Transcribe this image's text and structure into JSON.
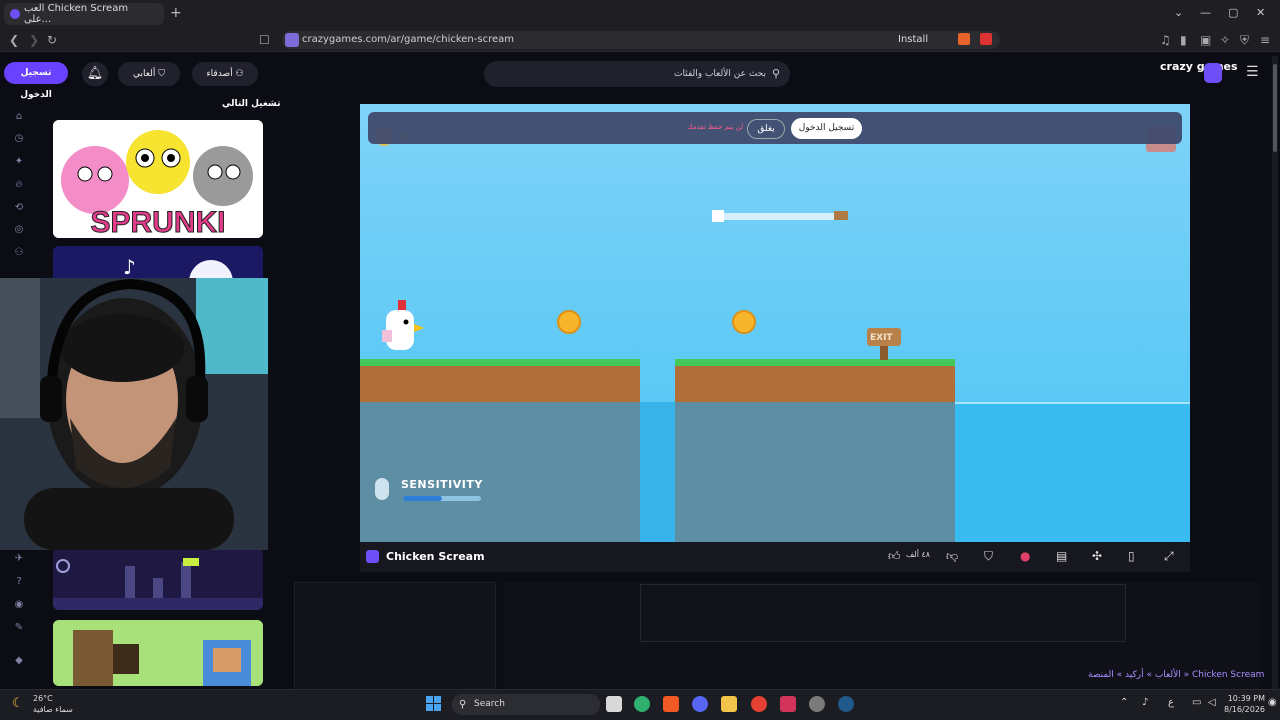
{
  "browser": {
    "tab_title": "العب Chicken Scream على...",
    "new_tab": "+",
    "url": "crazygames.com/ar/game/chicken-scream",
    "install_label": "Install",
    "minimize": "⌄  —  ▢  ✕"
  },
  "header": {
    "login": "تسجيل الدخول",
    "my_games": "ألعابي",
    "friends": "أصدقاء",
    "search_placeholder": "بحث عن الألعاب والفئات",
    "logo": "crazy games",
    "brand_color": "#6842ff"
  },
  "sidebar": {
    "next_play": "تشغيل التالي",
    "thumb1_text": "SPRUNKI"
  },
  "game": {
    "top_message": "لن يتم حفظ تقدمك",
    "skip": "يغلق",
    "login": "تسجيل الدخول",
    "sensitivity": "SENSITIVITY",
    "exit_sign": "EXIT",
    "sensitivity_level": 0.5
  },
  "gamebar": {
    "title": "Chicken Scream",
    "likes": "٤٨ ألف"
  },
  "breadcrumbs": "الألعاب » أركيد » المنصة » Chicken Scream",
  "taskbar": {
    "temp": "26°C",
    "weather": "سماء صافية",
    "search": "Search",
    "time": "10:39 PM",
    "date": "8/16/2026",
    "lang": "ع"
  }
}
